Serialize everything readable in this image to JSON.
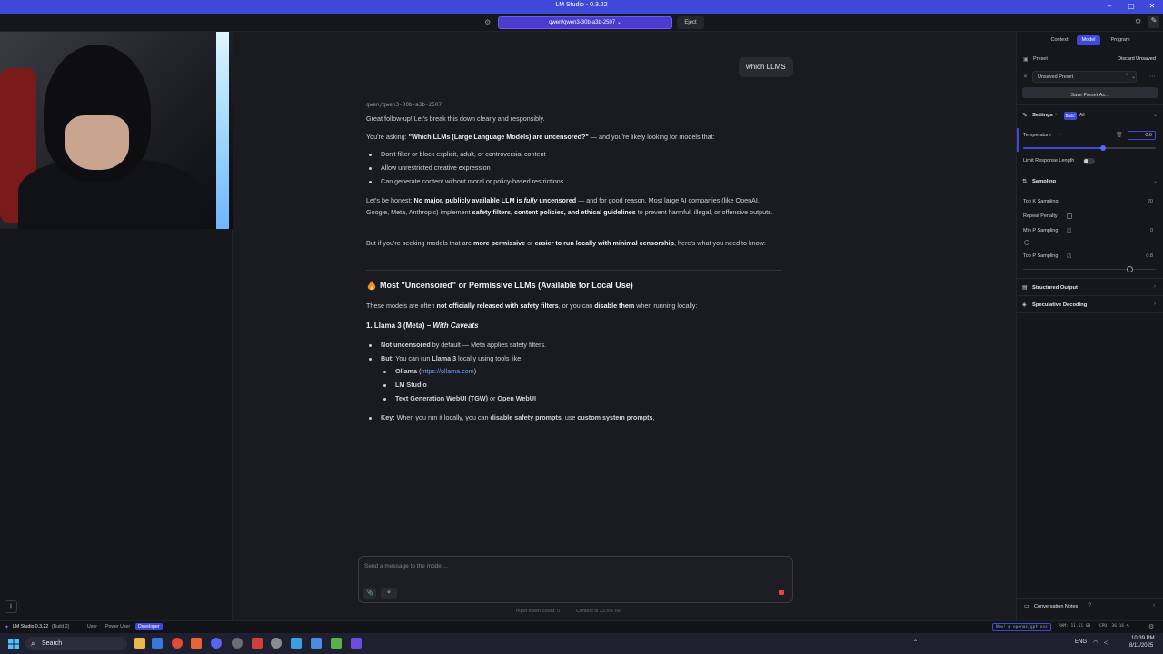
{
  "window": {
    "title": "LM Studio - 0.3.22",
    "minimize": "–",
    "maximize": "▢",
    "close": "✕"
  },
  "topbar": {
    "model": "qwen/qwen3-30b-a3b-2507",
    "eject": "Eject"
  },
  "chat": {
    "user_message": "which LLMS",
    "model_tag": "qwen/qwen3-30b-a3b-2507",
    "p1": "Great follow-up! Let's break this down clearly and responsibly.",
    "p2_a": "You're asking: ",
    "p2_b": "\"Which LLMs (Large Language Models) are uncensored?\"",
    "p2_c": " — and you're likely looking for models that:",
    "bullets1": [
      "Don't filter or block explicit, adult, or controversial content",
      "Allow unrestricted creative expression",
      "Can generate content without moral or policy-based restrictions"
    ],
    "p3_a": "Let's be honest: ",
    "p3_b": "No major, publicly available LLM is ",
    "p3_c": "fully",
    "p3_d": " uncensored",
    "p3_e": " — and for good reason. Most large AI companies (like OpenAI, Google, Meta, Anthropic) implement ",
    "p3_f": "safety filters, content policies, and ethical guidelines",
    "p3_g": " to prevent harmful, illegal, or offensive outputs.",
    "p4_a": "But if you're seeking models that are ",
    "p4_b": "more permissive",
    "p4_c": " or ",
    "p4_d": "easier to run locally with minimal censorship",
    "p4_e": ", here's what you need to know:",
    "h2": "Most \"Uncensored\" or Permissive LLMs (Available for Local Use)",
    "p5_a": "These models are often ",
    "p5_b": "not officially released with safety filters",
    "p5_c": ", or you can ",
    "p5_d": "disable them",
    "p5_e": " when running locally:",
    "h3_a": "1. Llama 3 (Meta) – ",
    "h3_b": "With Caveats",
    "l1_a": "Not uncensored",
    "l1_b": " by default — Meta applies safety filters.",
    "l2_a": "But:",
    "l2_b": " You can run ",
    "l2_c": "Llama 3",
    "l2_d": " locally using tools like:",
    "s1_a": "Ollama",
    "s1_b": " (",
    "s1_c": "https://ollama.com",
    "s1_d": ")",
    "s2": "LM Studio",
    "s3_a": "Text Generation WebUI (TGW)",
    "s3_b": " or ",
    "s3_c": "Open WebUI",
    "l3_a": "Key:",
    "l3_b": " When you run it locally, you can ",
    "l3_c": "disable safety prompts",
    "l3_d": ", use ",
    "l3_e": "custom system prompts",
    "l3_f": ","
  },
  "composer": {
    "placeholder": "Send a message to the model...",
    "attach_icon": "📎",
    "tools_icon": "⚘",
    "token_count": "Input token count:  0",
    "context": "Context is 23.5% full"
  },
  "rightpanel": {
    "tabs": [
      "Context",
      "Model",
      "Program"
    ],
    "preset_label": "Preset",
    "discard": "Discard Unsaved",
    "preset_value": "Unsaved Preset",
    "save_preset": "Save Preset As...",
    "settings": "Settings",
    "basic": "Basic",
    "all": "All",
    "temperature": "Temperature",
    "temperature_value": "0.6",
    "temperature_fraction": 0.6,
    "limit_length": "Limit Response Length",
    "sampling": "Sampling",
    "top_k": "Top K Sampling",
    "top_k_value": "20",
    "repeat_penalty": "Repeat Penalty",
    "min_p": "Min P Sampling",
    "min_p_value": "0",
    "top_p": "Top P Sampling",
    "top_p_value": "0.8",
    "structured_output": "Structured Output",
    "speculative_decoding": "Speculative Decoding",
    "conversation_notes": "Conversation Notes"
  },
  "statusbar": {
    "app": "LM Studio 0.3.22",
    "build": "(Build 2)",
    "modes": [
      "User",
      "Power User",
      "Developer"
    ],
    "new": "New! @ openai/gpt-oss",
    "ram": "RAM: 11.61 GB",
    "cpu": "CPU: 36.16 %"
  },
  "taskbar": {
    "search": "Search",
    "lang": "ENG",
    "time": "10:39 PM",
    "date": "8/11/2025"
  }
}
